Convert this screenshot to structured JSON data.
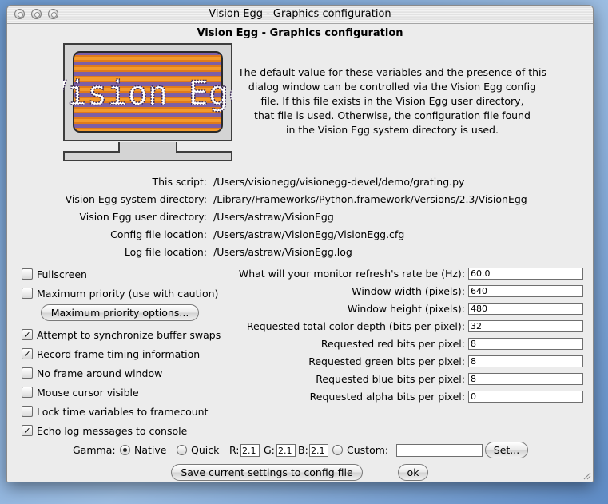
{
  "window": {
    "title": "Vision Egg - Graphics configuration"
  },
  "header": {
    "heading": "Vision Egg - Graphics configuration"
  },
  "logo": {
    "text": "Vision Egg",
    "colors": {
      "stripe_a": "#e07b1a",
      "stripe_b": "#7d5fa6",
      "led": "#3cff3c"
    }
  },
  "intro": {
    "lines": [
      "The default value for these variables and the presence of this",
      "dialog window can be controlled via the Vision Egg config",
      "file. If this file exists in the Vision Egg user directory,",
      "that file is used. Otherwise, the configuration file found",
      "in the Vision Egg system directory is used."
    ]
  },
  "paths": [
    {
      "label": "This script:",
      "value": "/Users/visionegg/visionegg-devel/demo/grating.py"
    },
    {
      "label": "Vision Egg system directory:",
      "value": "/Library/Frameworks/Python.framework/Versions/2.3/VisionEgg"
    },
    {
      "label": "Vision Egg user directory:",
      "value": "/Users/astraw/VisionEgg"
    },
    {
      "label": "Config file location:",
      "value": "/Users/astraw/VisionEgg/VisionEgg.cfg"
    },
    {
      "label": "Log file location:",
      "value": "/Users/astraw/VisionEgg.log"
    }
  ],
  "options": {
    "fullscreen": {
      "label": "Fullscreen",
      "checked": ""
    },
    "max_priority": {
      "label": "Maximum priority (use with caution)",
      "checked": ""
    },
    "max_priority_button": "Maximum priority options...",
    "sync_buffer": {
      "label": "Attempt to synchronize buffer swaps",
      "checked": "✓"
    },
    "record_timing": {
      "label": "Record frame timing information",
      "checked": "✓"
    },
    "no_frame": {
      "label": "No frame around window",
      "checked": ""
    },
    "mouse_visible": {
      "label": "Mouse cursor visible",
      "checked": ""
    },
    "lock_time": {
      "label": "Lock time variables to framecount",
      "checked": ""
    },
    "echo_log": {
      "label": "Echo log messages to console",
      "checked": "✓"
    }
  },
  "fields": [
    {
      "label": "What will your monitor refresh's rate be (Hz):",
      "value": "60.0"
    },
    {
      "label": "Window width (pixels):",
      "value": "640"
    },
    {
      "label": "Window height (pixels):",
      "value": "480"
    },
    {
      "label": "Requested total color depth (bits per pixel):",
      "value": "32"
    },
    {
      "label": "Requested red bits per pixel:",
      "value": "8"
    },
    {
      "label": "Requested green bits per pixel:",
      "value": "8"
    },
    {
      "label": "Requested blue bits per pixel:",
      "value": "8"
    },
    {
      "label": "Requested alpha bits per pixel:",
      "value": "0"
    }
  ],
  "gamma": {
    "label": "Gamma:",
    "native": "Native",
    "quick": "Quick",
    "r_label": "R:",
    "r_value": "2.1",
    "g_label": "G:",
    "g_value": "2.1",
    "b_label": "B:",
    "b_value": "2.1",
    "custom": "Custom:",
    "custom_value": "",
    "set_button": "Set...",
    "selected": "Native"
  },
  "footer": {
    "save_button": "Save current settings to config file",
    "ok_button": "ok"
  }
}
